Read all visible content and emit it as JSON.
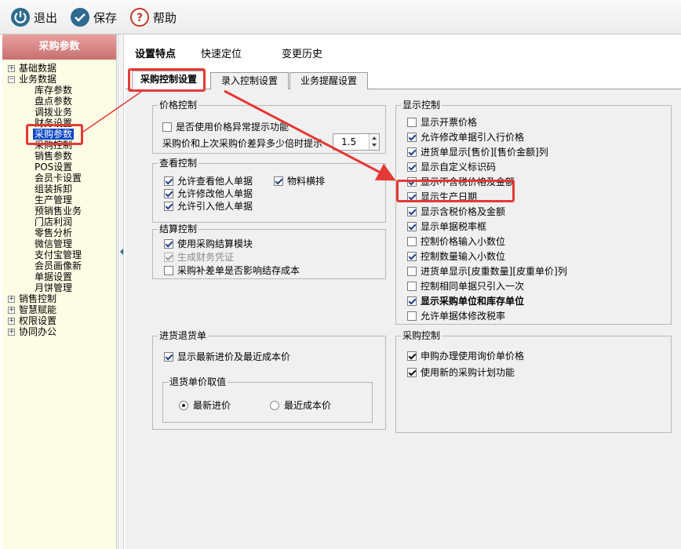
{
  "toolbar": {
    "exit": {
      "label": "退出",
      "icon": "exit-icon"
    },
    "save": {
      "label": "保存",
      "icon": "save-icon"
    },
    "help": {
      "label": "帮助",
      "icon": "help-icon"
    }
  },
  "sidebar": {
    "title": "采购参数",
    "tree": {
      "basic": "基础数据",
      "business": "业务数据",
      "business_children": [
        "库存参数",
        "盘点参数",
        "调拨业务",
        "财务设置",
        "采购参数",
        "采购控制",
        "销售参数",
        "POS设置",
        "会员卡设置",
        "组装拆卸",
        "生产管理",
        "预销售业务",
        "门店利润",
        "零售分析",
        "微信管理",
        "支付宝管理",
        "会员画像新",
        "单据设置",
        "月饼管理"
      ],
      "sales_control": "销售控制",
      "smart": "智慧赋能",
      "permissions": "权限设置",
      "collab": "协同办公"
    }
  },
  "main_tabs": [
    "设置特点",
    "快速定位",
    "变更历史"
  ],
  "sub_tabs": [
    "采购控制设置",
    "录入控制设置",
    "业务提醒设置"
  ],
  "price_control": {
    "title": "价格控制",
    "items": [
      {
        "label": "是否使用价格异常提示功能",
        "checked": false
      }
    ],
    "ratio_label": "采购价和上次采购价差异多少倍时提示",
    "ratio_value": "1.5"
  },
  "view_control": {
    "title": "查看控制",
    "items": [
      {
        "label": "允许查看他人单据",
        "checked": true
      },
      {
        "label": "允许修改他人单据",
        "checked": true
      },
      {
        "label": "允许引入他人单据",
        "checked": true
      },
      {
        "label": "物料横排",
        "checked": true
      }
    ]
  },
  "settlement_control": {
    "title": "结算控制",
    "items": [
      {
        "label": "使用采购结算模块",
        "checked": true
      },
      {
        "label": "生成财务凭证",
        "checked": true,
        "disabled": true
      },
      {
        "label": "采购补差单是否影响结存成本",
        "checked": false
      }
    ]
  },
  "return_doc": {
    "title": "进货退货单",
    "items": [
      {
        "label": "显示最新进价及最近成本价",
        "checked": true
      }
    ],
    "price_title": "退货单价取值",
    "options": [
      {
        "label": "最新进价",
        "selected": true
      },
      {
        "label": "最近成本价",
        "selected": false
      }
    ]
  },
  "display_control": {
    "title": "显示控制",
    "items": [
      {
        "label": "显示开票价格",
        "checked": false
      },
      {
        "label": "允许修改单据引入行价格",
        "checked": true
      },
      {
        "label": "进货单显示[售价][售价金额]列",
        "checked": true
      },
      {
        "label": "显示自定义标识码",
        "checked": true
      },
      {
        "label": "显示不含税价格及金额",
        "checked": true
      },
      {
        "label": "显示生产日期",
        "checked": true
      },
      {
        "label": "显示含税价格及金额",
        "checked": true
      },
      {
        "label": "显示单据税率框",
        "checked": true
      },
      {
        "label": "控制价格输入小数位",
        "checked": false
      },
      {
        "label": "控制数量输入小数位",
        "checked": true
      },
      {
        "label": "进货单显示[皮重数量][皮重单价]列",
        "checked": false
      },
      {
        "label": "控制相同单据只引入一次",
        "checked": false
      },
      {
        "label": "显示采购单位和库存单位",
        "checked": true,
        "bold": true
      },
      {
        "label": "允许单据体修改税率",
        "checked": false
      }
    ]
  },
  "purchase_control": {
    "title": "采购控制",
    "items": [
      {
        "label": "申购办理使用询价单价格",
        "checked": true
      },
      {
        "label": "使用新的采购计划功能",
        "checked": true
      }
    ]
  },
  "colors": {
    "accent": "#e53935",
    "sidebar_header": "#c97070",
    "selection": "#0a46c8"
  }
}
